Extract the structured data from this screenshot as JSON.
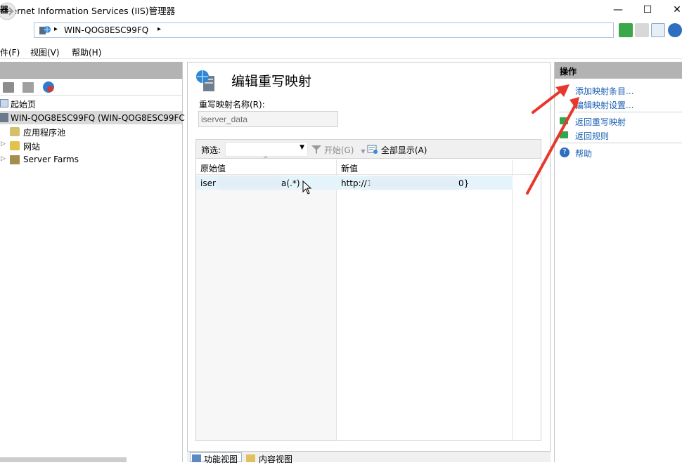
{
  "window": {
    "title": "Internet Information Services (IIS)管理器",
    "minimize_glyph": "—",
    "maximize_glyph": "☐",
    "close_glyph": "✕"
  },
  "address": {
    "path_separator": "▸",
    "server": "WIN-QOG8ESC99FQ",
    "trailing_separator": "▸"
  },
  "menu": {
    "items": [
      "件(F)",
      "视图(V)",
      "帮助(H)"
    ]
  },
  "left_panel": {
    "header": "器",
    "tree": [
      {
        "label": "起始页"
      },
      {
        "label": "WIN-QOG8ESC99FQ (WIN-QOG8ESC99FC"
      },
      {
        "label": "应用程序池"
      },
      {
        "label": "网站"
      },
      {
        "label": "Server Farms"
      }
    ]
  },
  "center": {
    "title": "编辑重写映射",
    "map_name_label": "重写映射名称(R):",
    "map_name_value": "iserver_data",
    "filter_label": "筛选:",
    "start_label": "开始(G)",
    "show_all_label": "全部显示(A)",
    "columns": {
      "original": "原始值",
      "new": "新值"
    },
    "rows": [
      {
        "original_start": "iser",
        "original_end": "a(.*)",
        "new_start": "http://1",
        "new_end": "0}"
      }
    ]
  },
  "bottom_tabs": {
    "features_view": "功能视图",
    "content_view": "内容视图"
  },
  "right_panel": {
    "header": "操作",
    "actions": [
      {
        "label": "添加映射条目..."
      },
      {
        "label": "编辑映射设置..."
      },
      {
        "label": "返回重写映射"
      },
      {
        "label": "返回规则"
      },
      {
        "label": "帮助"
      }
    ]
  },
  "colors": {
    "panel_header": "#b3b3b3",
    "link": "#1a5fb4",
    "selected_row": "#e5f3fb",
    "annotation_arrow": "#e8372c"
  }
}
